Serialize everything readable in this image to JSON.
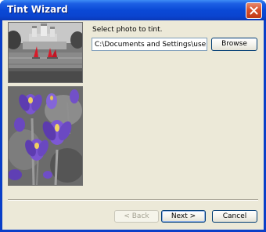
{
  "window": {
    "title": "Tint Wizard"
  },
  "titlebar": {
    "close_icon": "close-icon"
  },
  "main": {
    "prompt": "Select photo to tint.",
    "path_value": "C:\\Documents and Settings\\user\\My D",
    "browse_label": "Browse"
  },
  "photos": {
    "preview_top": "castle-river-photo",
    "preview_bottom": "purple-crocus-photo"
  },
  "footer": {
    "back_label": "< Back",
    "next_label": "Next >",
    "cancel_label": "Cancel"
  },
  "colors": {
    "titlebar": "#0a49d6",
    "dialog_bg": "#ece9d8",
    "close_red": "#d7502e",
    "tint_purple": "#7a55d0"
  }
}
